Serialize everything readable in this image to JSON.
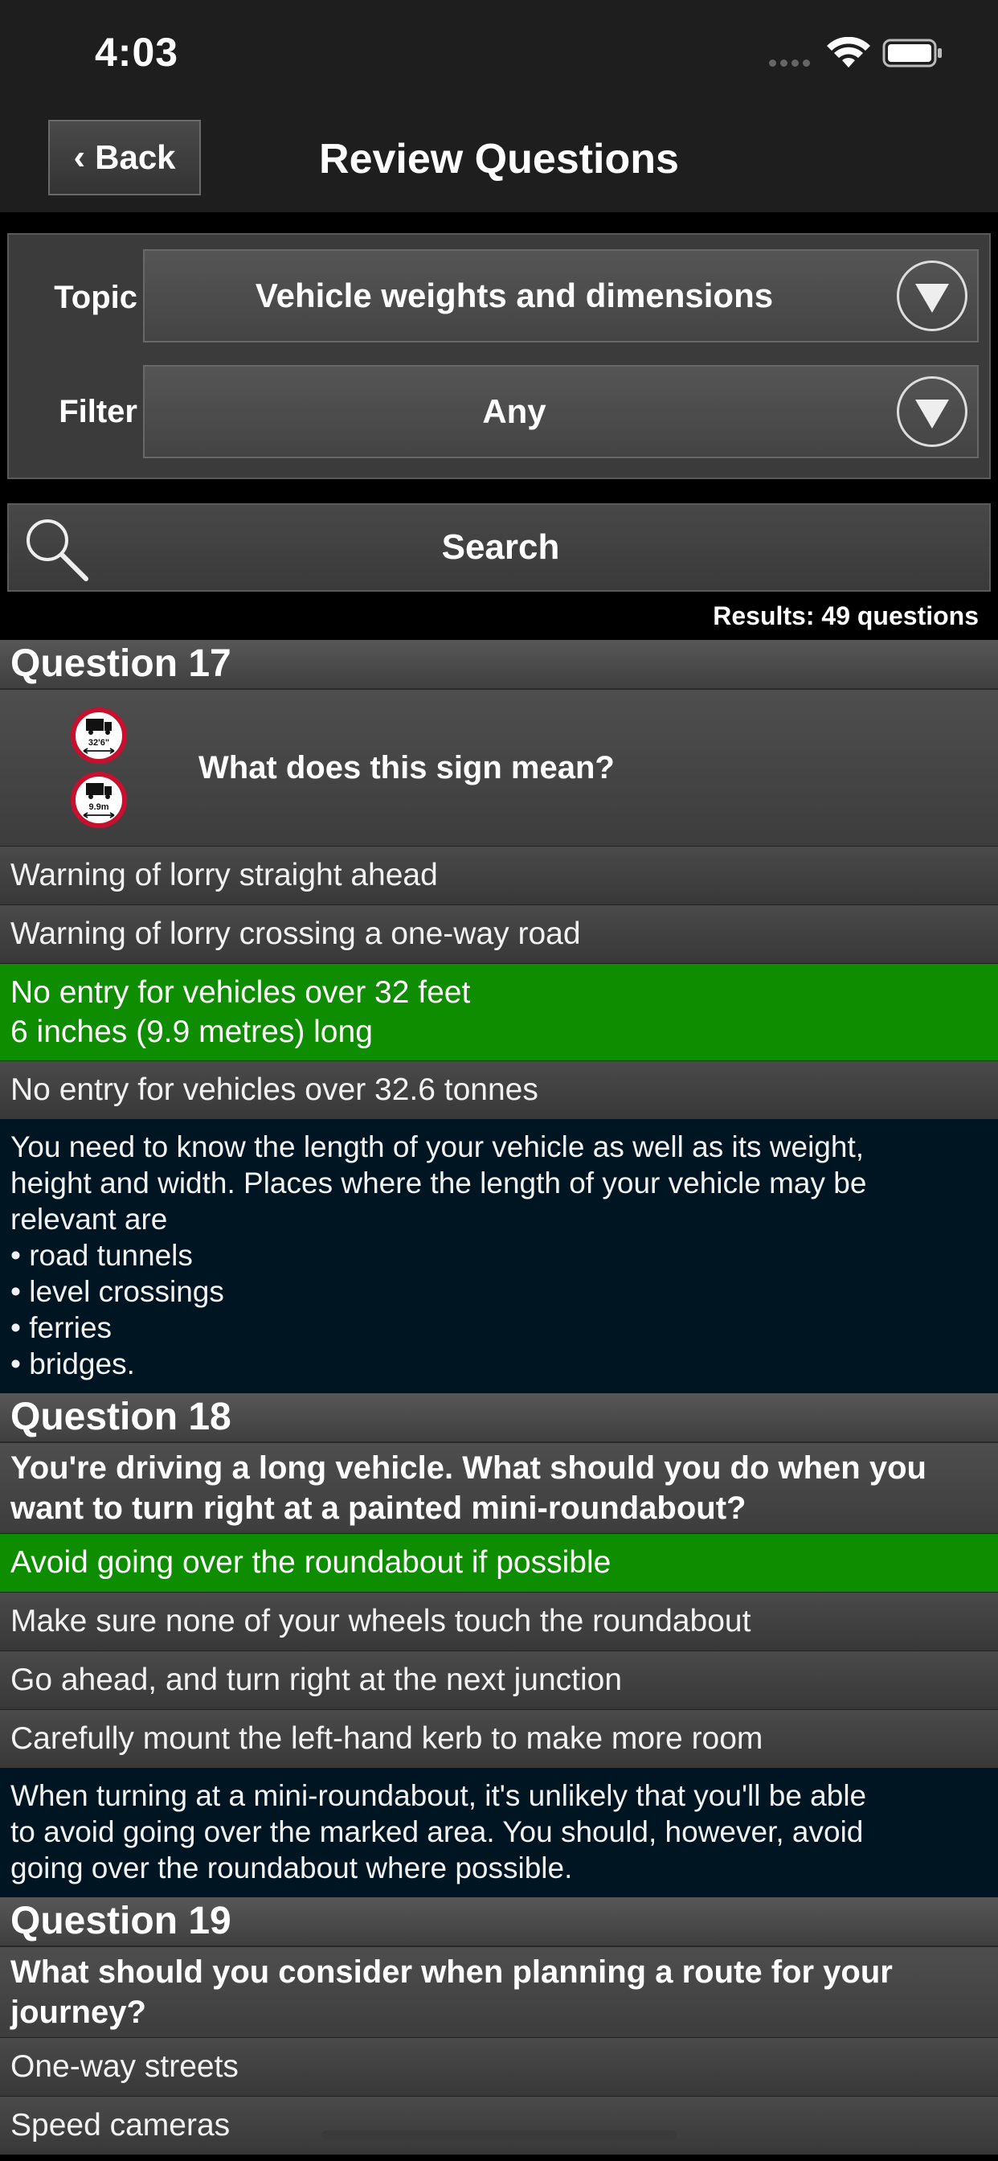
{
  "status": {
    "time": "4:03"
  },
  "nav": {
    "back_label": "Back",
    "title": "Review Questions"
  },
  "filters": {
    "topic_label": "Topic",
    "topic_value": "Vehicle weights and dimensions",
    "filter_label": "Filter",
    "filter_value": "Any"
  },
  "search": {
    "label": "Search"
  },
  "results": {
    "text": "Results: 49 questions"
  },
  "questions": [
    {
      "header": "Question 17",
      "text": "What does this sign mean?",
      "sign_labels": [
        "32'6\"",
        "9.9m"
      ],
      "answers": [
        {
          "text": "Warning of lorry straight ahead",
          "correct": false
        },
        {
          "text": "Warning of lorry crossing a one-way road",
          "correct": false
        },
        {
          "text": "No entry for vehicles over 32 feet\n6 inches (9.9 metres) long",
          "correct": true
        },
        {
          "text": "No entry for vehicles over 32.6 tonnes",
          "correct": false
        }
      ],
      "explanation": [
        "You need to know the length of your vehicle as well as its weight,",
        "height and width. Places where the length of your vehicle may be",
        "relevant are",
        "• road tunnels",
        "• level crossings",
        "• ferries",
        "• bridges."
      ]
    },
    {
      "header": "Question 18",
      "text": "You're driving a long vehicle. What should you do when you want to turn right at a painted mini-roundabout?",
      "answers": [
        {
          "text": "Avoid going over the roundabout if possible",
          "correct": true
        },
        {
          "text": "Make sure none of your wheels touch the roundabout",
          "correct": false
        },
        {
          "text": "Go ahead, and turn right at the next junction",
          "correct": false
        },
        {
          "text": "Carefully mount the left-hand kerb to make more room",
          "correct": false
        }
      ],
      "explanation": [
        "When turning at a mini-roundabout, it's unlikely that you'll be able",
        "to avoid going over the marked area. You should, however, avoid",
        "going over the roundabout where possible."
      ]
    },
    {
      "header": "Question 19",
      "text": "What should you consider when planning a route for your journey?",
      "answers": [
        {
          "text": "One-way streets",
          "correct": false
        },
        {
          "text": "Speed cameras",
          "correct": false
        }
      ]
    }
  ],
  "colors": {
    "correct": "#0e8d00",
    "explanation_bg": "#001522"
  }
}
